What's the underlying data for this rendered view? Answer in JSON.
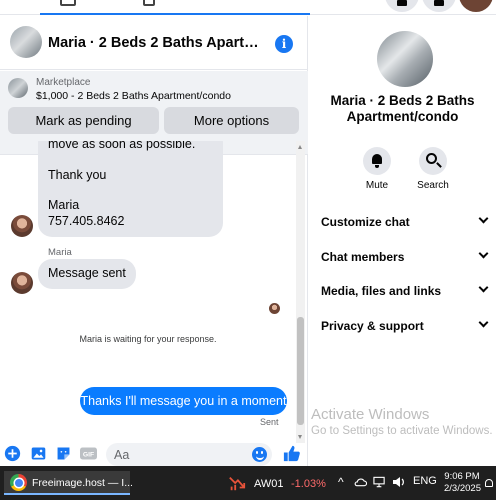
{
  "chat": {
    "title": "Maria · 2 Beds 2 Baths Apartment/condo",
    "marketplace": {
      "label": "Marketplace",
      "listing": "$1,000 - 2 Beds 2 Baths Apartment/condo",
      "mark_pending_label": "Mark as pending",
      "more_options_label": "More options"
    },
    "messages": {
      "partial_line": "move as soon as possible.",
      "thanks": "Thank you",
      "signature_name": "Maria",
      "phone": "757.405.8462",
      "sender_name": "Maria",
      "message_sent": "Message sent",
      "waiting": "Maria is waiting for your response.",
      "outgoing": "Thanks I'll message you in a moment",
      "status": "Sent"
    },
    "composer": {
      "placeholder": "Aa",
      "icons": [
        "plus-circle-icon",
        "photo-icon",
        "sticker-icon",
        "gif-icon",
        "emoji-icon",
        "like-icon"
      ],
      "gif_label": "GIF"
    }
  },
  "info_panel": {
    "name": "Maria · 2 Beds 2 Baths Apartment/condo",
    "actions": [
      {
        "label": "Mute",
        "icon": "bell-icon"
      },
      {
        "label": "Search",
        "icon": "search-icon"
      }
    ],
    "sections": [
      {
        "label": "Customize chat"
      },
      {
        "label": "Chat members"
      },
      {
        "label": "Media, files and links"
      },
      {
        "label": "Privacy & support"
      }
    ]
  },
  "watermark": {
    "title": "Activate Windows",
    "subtitle": "Go to Settings to activate Windows."
  },
  "taskbar": {
    "app_label": "Freeimage.host — I...",
    "ticker": "AW01",
    "change": "-1.03%",
    "language": "ENG",
    "time": "9:06 PM",
    "date": "2/3/2025"
  },
  "colors": {
    "accent": "#1877f2",
    "outgoing_bubble": "#0a7cff",
    "incoming_bubble": "#e4e6eb",
    "negative": "#ff6b6b"
  }
}
